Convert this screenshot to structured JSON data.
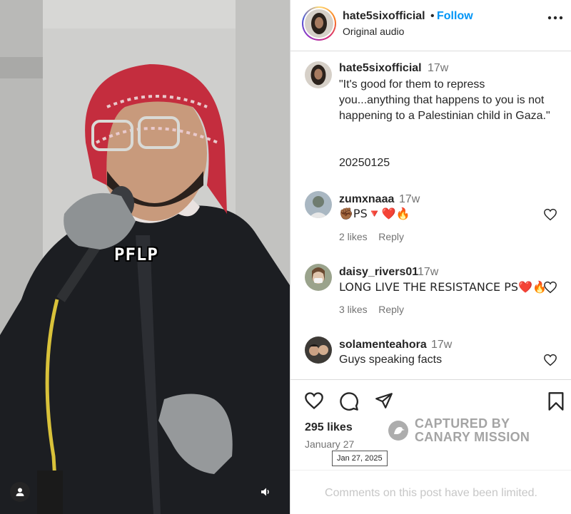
{
  "media": {
    "caption": "PFLP"
  },
  "post": {
    "author": "hate5sixofficial",
    "separator": "•",
    "follow_label": "Follow",
    "audio_label": "Original audio"
  },
  "caption": {
    "username": "hate5sixofficial",
    "time": "17w",
    "text": "\"It's good for them to repress you...anything that happens to you is not happening to a Palestinian child in Gaza.\"",
    "tag": "20250125"
  },
  "comments": [
    {
      "username": "zumxnaaa",
      "time": "17w",
      "text": "✊🏾PS🔻❤️🔥",
      "likes": "2 likes",
      "reply": "Reply"
    },
    {
      "username": "daisy_rivers01",
      "time": "17w",
      "text": "LONG LIVE THE RESISTANCE PS❤️🔥",
      "likes": "3 likes",
      "reply": "Reply"
    },
    {
      "username": "solamenteahora",
      "time": "17w",
      "text": "Guys speaking facts"
    }
  ],
  "footer": {
    "likes": "295 likes",
    "date": "January 27",
    "date_tooltip": "Jan 27, 2025",
    "limited_notice": "Comments on this post have been limited."
  },
  "watermark": {
    "line1": "CAPTURED BY",
    "line2": "CANARY MISSION"
  },
  "icons": [
    "more-icon",
    "heart-icon",
    "comment-icon",
    "share-icon",
    "bookmark-icon",
    "tagged-user-icon",
    "audio-icon"
  ],
  "colors": {
    "link": "#0095f6",
    "muted": "#737373",
    "border": "#dbdbdb"
  }
}
